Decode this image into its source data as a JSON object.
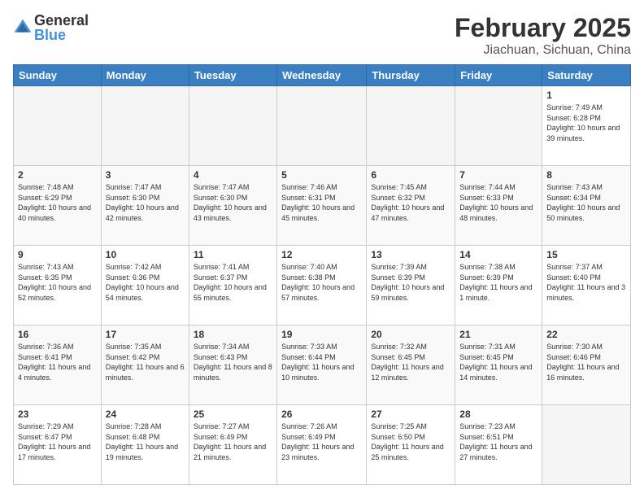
{
  "logo": {
    "general": "General",
    "blue": "Blue"
  },
  "title": "February 2025",
  "subtitle": "Jiachuan, Sichuan, China",
  "days_of_week": [
    "Sunday",
    "Monday",
    "Tuesday",
    "Wednesday",
    "Thursday",
    "Friday",
    "Saturday"
  ],
  "weeks": [
    [
      {
        "day": "",
        "empty": true
      },
      {
        "day": "",
        "empty": true
      },
      {
        "day": "",
        "empty": true
      },
      {
        "day": "",
        "empty": true
      },
      {
        "day": "",
        "empty": true
      },
      {
        "day": "",
        "empty": true
      },
      {
        "day": "1",
        "sunrise": "7:49 AM",
        "sunset": "6:28 PM",
        "daylight": "10 hours and 39 minutes."
      }
    ],
    [
      {
        "day": "2",
        "sunrise": "7:48 AM",
        "sunset": "6:29 PM",
        "daylight": "10 hours and 40 minutes."
      },
      {
        "day": "3",
        "sunrise": "7:47 AM",
        "sunset": "6:30 PM",
        "daylight": "10 hours and 42 minutes."
      },
      {
        "day": "4",
        "sunrise": "7:47 AM",
        "sunset": "6:30 PM",
        "daylight": "10 hours and 43 minutes."
      },
      {
        "day": "5",
        "sunrise": "7:46 AM",
        "sunset": "6:31 PM",
        "daylight": "10 hours and 45 minutes."
      },
      {
        "day": "6",
        "sunrise": "7:45 AM",
        "sunset": "6:32 PM",
        "daylight": "10 hours and 47 minutes."
      },
      {
        "day": "7",
        "sunrise": "7:44 AM",
        "sunset": "6:33 PM",
        "daylight": "10 hours and 48 minutes."
      },
      {
        "day": "8",
        "sunrise": "7:43 AM",
        "sunset": "6:34 PM",
        "daylight": "10 hours and 50 minutes."
      }
    ],
    [
      {
        "day": "9",
        "sunrise": "7:43 AM",
        "sunset": "6:35 PM",
        "daylight": "10 hours and 52 minutes."
      },
      {
        "day": "10",
        "sunrise": "7:42 AM",
        "sunset": "6:36 PM",
        "daylight": "10 hours and 54 minutes."
      },
      {
        "day": "11",
        "sunrise": "7:41 AM",
        "sunset": "6:37 PM",
        "daylight": "10 hours and 55 minutes."
      },
      {
        "day": "12",
        "sunrise": "7:40 AM",
        "sunset": "6:38 PM",
        "daylight": "10 hours and 57 minutes."
      },
      {
        "day": "13",
        "sunrise": "7:39 AM",
        "sunset": "6:39 PM",
        "daylight": "10 hours and 59 minutes."
      },
      {
        "day": "14",
        "sunrise": "7:38 AM",
        "sunset": "6:39 PM",
        "daylight": "11 hours and 1 minute."
      },
      {
        "day": "15",
        "sunrise": "7:37 AM",
        "sunset": "6:40 PM",
        "daylight": "11 hours and 3 minutes."
      }
    ],
    [
      {
        "day": "16",
        "sunrise": "7:36 AM",
        "sunset": "6:41 PM",
        "daylight": "11 hours and 4 minutes."
      },
      {
        "day": "17",
        "sunrise": "7:35 AM",
        "sunset": "6:42 PM",
        "daylight": "11 hours and 6 minutes."
      },
      {
        "day": "18",
        "sunrise": "7:34 AM",
        "sunset": "6:43 PM",
        "daylight": "11 hours and 8 minutes."
      },
      {
        "day": "19",
        "sunrise": "7:33 AM",
        "sunset": "6:44 PM",
        "daylight": "11 hours and 10 minutes."
      },
      {
        "day": "20",
        "sunrise": "7:32 AM",
        "sunset": "6:45 PM",
        "daylight": "11 hours and 12 minutes."
      },
      {
        "day": "21",
        "sunrise": "7:31 AM",
        "sunset": "6:45 PM",
        "daylight": "11 hours and 14 minutes."
      },
      {
        "day": "22",
        "sunrise": "7:30 AM",
        "sunset": "6:46 PM",
        "daylight": "11 hours and 16 minutes."
      }
    ],
    [
      {
        "day": "23",
        "sunrise": "7:29 AM",
        "sunset": "6:47 PM",
        "daylight": "11 hours and 17 minutes."
      },
      {
        "day": "24",
        "sunrise": "7:28 AM",
        "sunset": "6:48 PM",
        "daylight": "11 hours and 19 minutes."
      },
      {
        "day": "25",
        "sunrise": "7:27 AM",
        "sunset": "6:49 PM",
        "daylight": "11 hours and 21 minutes."
      },
      {
        "day": "26",
        "sunrise": "7:26 AM",
        "sunset": "6:49 PM",
        "daylight": "11 hours and 23 minutes."
      },
      {
        "day": "27",
        "sunrise": "7:25 AM",
        "sunset": "6:50 PM",
        "daylight": "11 hours and 25 minutes."
      },
      {
        "day": "28",
        "sunrise": "7:23 AM",
        "sunset": "6:51 PM",
        "daylight": "11 hours and 27 minutes."
      },
      {
        "day": "",
        "empty": true
      }
    ]
  ]
}
